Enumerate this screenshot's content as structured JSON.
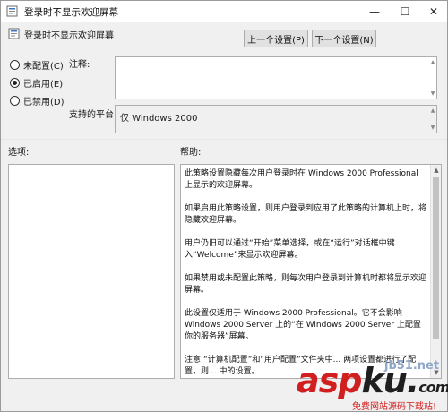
{
  "window": {
    "title": "登录时不显示欢迎屏幕",
    "controls": {
      "minimize": "—",
      "maximize": "☐",
      "close": "✕"
    }
  },
  "header": {
    "policy_name": "登录时不显示欢迎屏幕",
    "prev_button": "上一个设置(P)",
    "next_button": "下一个设置(N)"
  },
  "state": {
    "options": [
      {
        "label": "未配置(C)",
        "selected": false
      },
      {
        "label": "已启用(E)",
        "selected": true
      },
      {
        "label": "已禁用(D)",
        "selected": false
      }
    ]
  },
  "comment": {
    "label": "注释:",
    "value": ""
  },
  "platform": {
    "label": "支持的平台:",
    "value": "仅 Windows 2000"
  },
  "options_panel": {
    "label": "选项:"
  },
  "help_panel": {
    "label": "帮助:",
    "paragraphs": [
      "此策略设置隐藏每次用户登录时在 Windows 2000 Professional 上显示的欢迎屏幕。",
      "如果启用此策略设置，则用户登录到应用了此策略的计算机上时，将隐藏欢迎屏幕。",
      "用户仍旧可以通过“开始”菜单选择，或在“运行”对话框中键入“Welcome”来显示欢迎屏幕。",
      "如果禁用或未配置此策略，则每次用户登录到计算机时都将显示欢迎屏幕。",
      "此设置仅适用于 Windows 2000 Professional。它不会影响 Windows 2000 Server 上的“在 Windows 2000 Server 上配置你的服务器”屏幕。",
      "注意:“计算机配置”和“用户配置”文件夹中... 两项设置都进行了配置，则... 中的设置。"
    ]
  },
  "watermark": {
    "brand_red": "asp",
    "brand_black": "ku",
    "brand_dot": ".",
    "brand_tld": "com",
    "site": "jb51.net",
    "tagline": "免费网站源码下载站!"
  },
  "colors": {
    "accent_red": "#d11f1f",
    "window_bg": "#f0f0f0"
  }
}
